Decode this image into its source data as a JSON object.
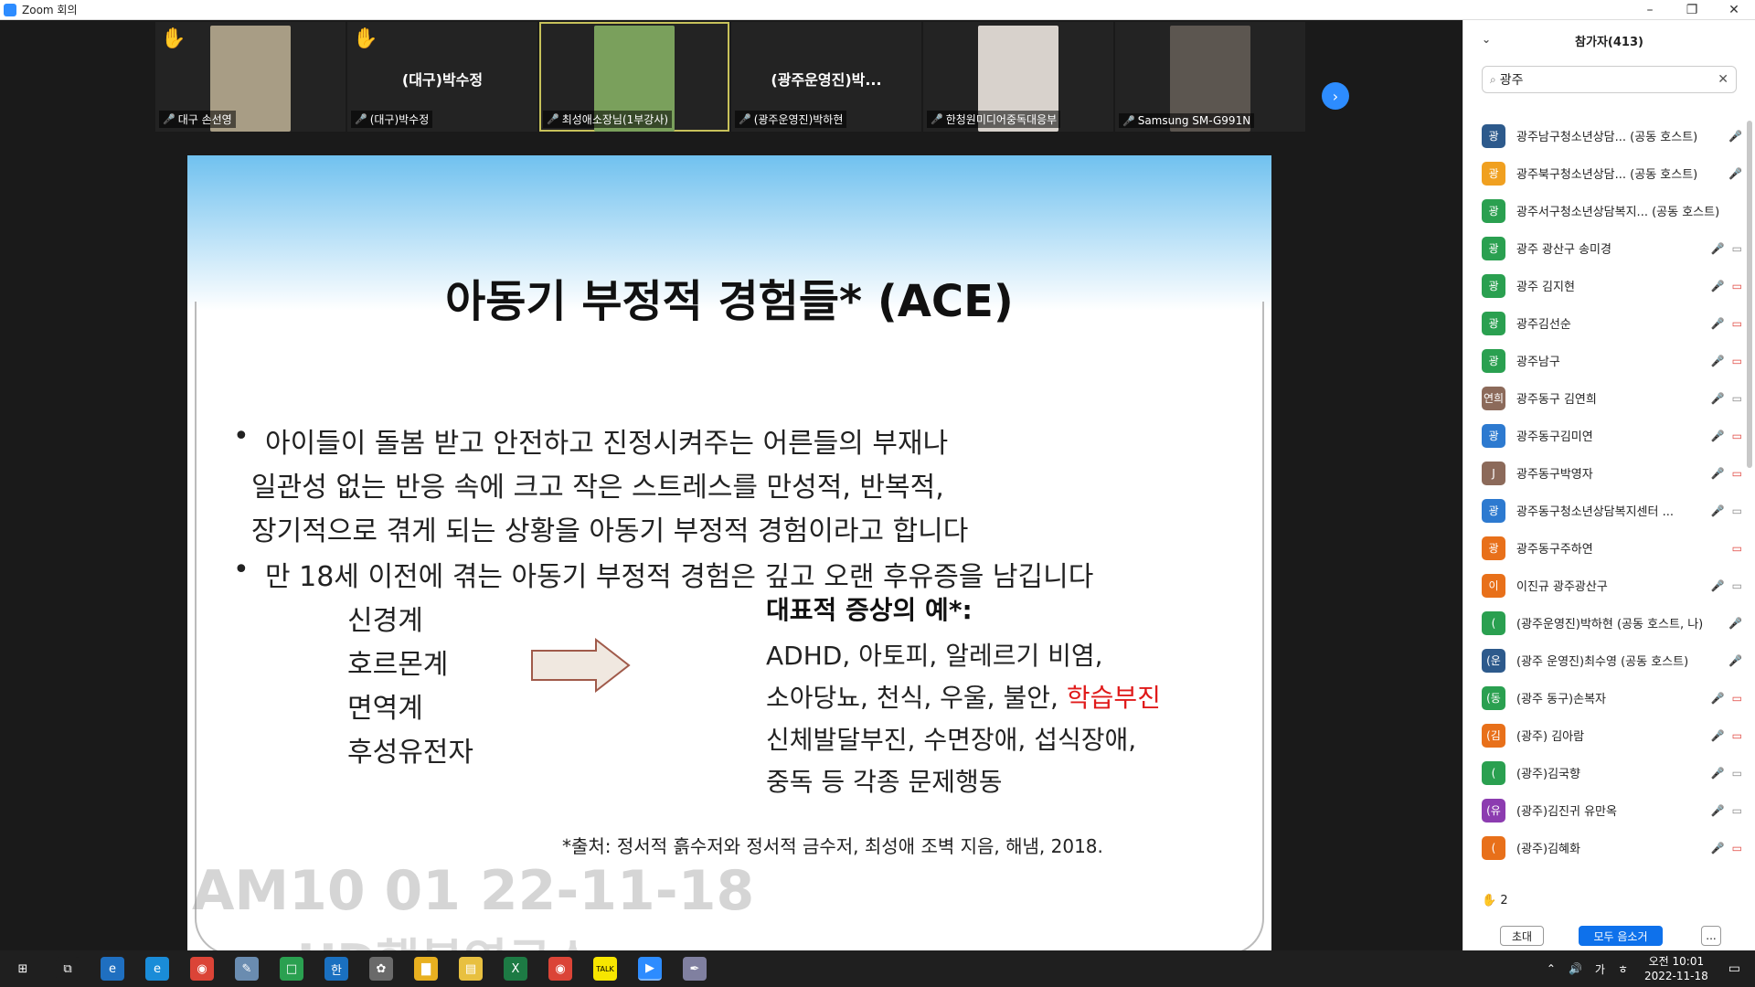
{
  "window": {
    "title": "Zoom 회의",
    "minimize": "–",
    "restore": "❐",
    "close": "✕"
  },
  "gallery": [
    {
      "name": "대구 손선영",
      "big": "",
      "hand": true,
      "photo_color": "#a89d85"
    },
    {
      "name": "(대구)박수정",
      "big": "(대구)박수정",
      "hand": true,
      "photo_color": ""
    },
    {
      "name": "최성애소장님(1부강사)",
      "big": "",
      "hand": false,
      "photo_color": "#7aa05c"
    },
    {
      "name": "(광주운영진)박하현",
      "big": "(광주운영진)박...",
      "hand": false,
      "photo_color": ""
    },
    {
      "name": "한청원미디어중독대응부",
      "big": "",
      "hand": false,
      "photo_color": "#d8d2cc"
    },
    {
      "name": "Samsung SM-G991N",
      "big": "",
      "hand": false,
      "photo_color": "#5c5650"
    }
  ],
  "slide": {
    "title": "아동기 부정적 경험들* (ACE)",
    "bullet1_l1": "아이들이 돌봄 받고 안전하고 진정시켜주는 어른들의 부재나",
    "bullet1_l2": "일관성 없는 반응 속에 크고 작은 스트레스를 만성적, 반복적,",
    "bullet1_l3": "장기적으로 겪게 되는 상황을 아동기 부정적 경험이라고 합니다",
    "bullet2": "만 18세 이전에 겪는 아동기 부정적 경험은 깊고 오랜 후유증을 남깁니다",
    "systems": [
      "신경계",
      "호르몬계",
      "면역계",
      "후성유전자"
    ],
    "symptoms_title": "대표적 증상의 예*:",
    "sym1": "ADHD, 아토피, 알레르기 비염,",
    "sym2_pre": "소아당뇨, 천식, 우울, 불안, ",
    "sym2_red": "학습부진",
    "sym3": "신체발달부진, 수면장애, 섭식장애,",
    "sym4": "중독 등 각종 문제행동",
    "source": "*출처: 정서적 흙수저와 정서적 금수저, 최성애 조벽 지음, 해냄, 2018.",
    "watermark_time": "AM10 01 22-11-18",
    "watermark_org": "HD행복연구소"
  },
  "panel": {
    "title": "참가자(413)",
    "search_value": "광주",
    "participants": [
      {
        "initial": "광",
        "color": "#2d5a8c",
        "name": "광주남구청소년상담... (공동 호스트)",
        "mic_off": true,
        "cam": ""
      },
      {
        "initial": "광",
        "color": "#f0a020",
        "name": "광주북구청소년상담... (공동 호스트)",
        "mic_off": true,
        "cam": ""
      },
      {
        "initial": "광",
        "color": "#2aa050",
        "name": "광주서구청소년상담복지... (공동 호스트)",
        "mic_off": false,
        "cam": ""
      },
      {
        "initial": "광",
        "color": "#2aa050",
        "name": "광주 광산구 송미경",
        "mic_off": true,
        "cam": "on"
      },
      {
        "initial": "광",
        "color": "#2aa050",
        "name": "광주 김지현",
        "mic_off": true,
        "cam": "off"
      },
      {
        "initial": "광",
        "color": "#2aa050",
        "name": "광주김선순",
        "mic_off": true,
        "cam": "off"
      },
      {
        "initial": "광",
        "color": "#2aa050",
        "name": "광주남구",
        "mic_off": true,
        "cam": "off"
      },
      {
        "initial": "연희",
        "color": "#8c6a5a",
        "name": "광주동구 김연희",
        "mic_off": true,
        "cam": "on"
      },
      {
        "initial": "광",
        "color": "#2d7ad0",
        "name": "광주동구김미연",
        "mic_off": true,
        "cam": "off"
      },
      {
        "initial": "J",
        "color": "#8c6a5a",
        "name": "광주동구박영자",
        "mic_off": true,
        "cam": "off"
      },
      {
        "initial": "광",
        "color": "#2d7ad0",
        "name": "광주동구청소년상담복지센터 ...",
        "mic_off": true,
        "cam": "on"
      },
      {
        "initial": "광",
        "color": "#e8701a",
        "name": "광주동구주하연",
        "mic_off": false,
        "cam": "off"
      },
      {
        "initial": "이",
        "color": "#e8701a",
        "name": "이진규 광주광산구",
        "mic_off": true,
        "cam": "on"
      },
      {
        "initial": "(",
        "color": "#2aa050",
        "name": "(광주운영진)박하현 (공동 호스트, 나)",
        "mic_off": true,
        "cam": ""
      },
      {
        "initial": "(운",
        "color": "#2d5a8c",
        "name": "(광주 운영진)최수영 (공동 호스트)",
        "mic_off": true,
        "cam": ""
      },
      {
        "initial": "(동",
        "color": "#2aa050",
        "name": "(광주 동구)손복자",
        "mic_off": true,
        "cam": "off"
      },
      {
        "initial": "(김",
        "color": "#e8701a",
        "name": "(광주) 김아람",
        "mic_off": true,
        "cam": "off"
      },
      {
        "initial": "(",
        "color": "#2aa050",
        "name": "(광주)김국향",
        "mic_off": true,
        "cam": "on"
      },
      {
        "initial": "(유",
        "color": "#8c3cb0",
        "name": "(광주)김진귀 유만옥",
        "mic_off": true,
        "cam": "on"
      },
      {
        "initial": "(",
        "color": "#e8701a",
        "name": "(광주)김혜화",
        "mic_off": true,
        "cam": "off"
      }
    ],
    "hand_count": "2",
    "invite_label": "초대",
    "mute_all_label": "모두 음소거",
    "more_label": "..."
  },
  "taskbar": {
    "apps": [
      {
        "icon": "task-view-icon",
        "glyph": "⧉",
        "color": "#1f1f1f"
      },
      {
        "icon": "ie-icon",
        "glyph": "e",
        "color": "#1f6fc0"
      },
      {
        "icon": "edge-icon",
        "glyph": "e",
        "color": "#1a8cd8"
      },
      {
        "icon": "chrome-icon",
        "glyph": "◉",
        "color": "#db4437"
      },
      {
        "icon": "notes-icon",
        "glyph": "✎",
        "color": "#6a8cb0"
      },
      {
        "icon": "app-icon",
        "glyph": "□",
        "color": "#2aa050"
      },
      {
        "icon": "hwp-icon",
        "glyph": "한",
        "color": "#1a70c0"
      },
      {
        "icon": "paint-icon",
        "glyph": "✿",
        "color": "#6a6a6a"
      },
      {
        "icon": "explorer-icon",
        "glyph": "▇",
        "color": "#e8b020"
      },
      {
        "icon": "files-icon",
        "glyph": "▤",
        "color": "#e8c040"
      },
      {
        "icon": "excel-icon",
        "glyph": "X",
        "color": "#1d7a44"
      },
      {
        "icon": "chrome2-icon",
        "glyph": "◉",
        "color": "#db4437"
      },
      {
        "icon": "kakaotalk-icon",
        "glyph": "TALK",
        "color": "#f7e600"
      },
      {
        "icon": "zoom-icon",
        "glyph": "▶",
        "color": "#2d8cff"
      },
      {
        "icon": "pen-icon",
        "glyph": "✒",
        "color": "#8080a0"
      }
    ],
    "tray_lang": "가",
    "time": "오전 10:01",
    "date": "2022-11-18"
  }
}
